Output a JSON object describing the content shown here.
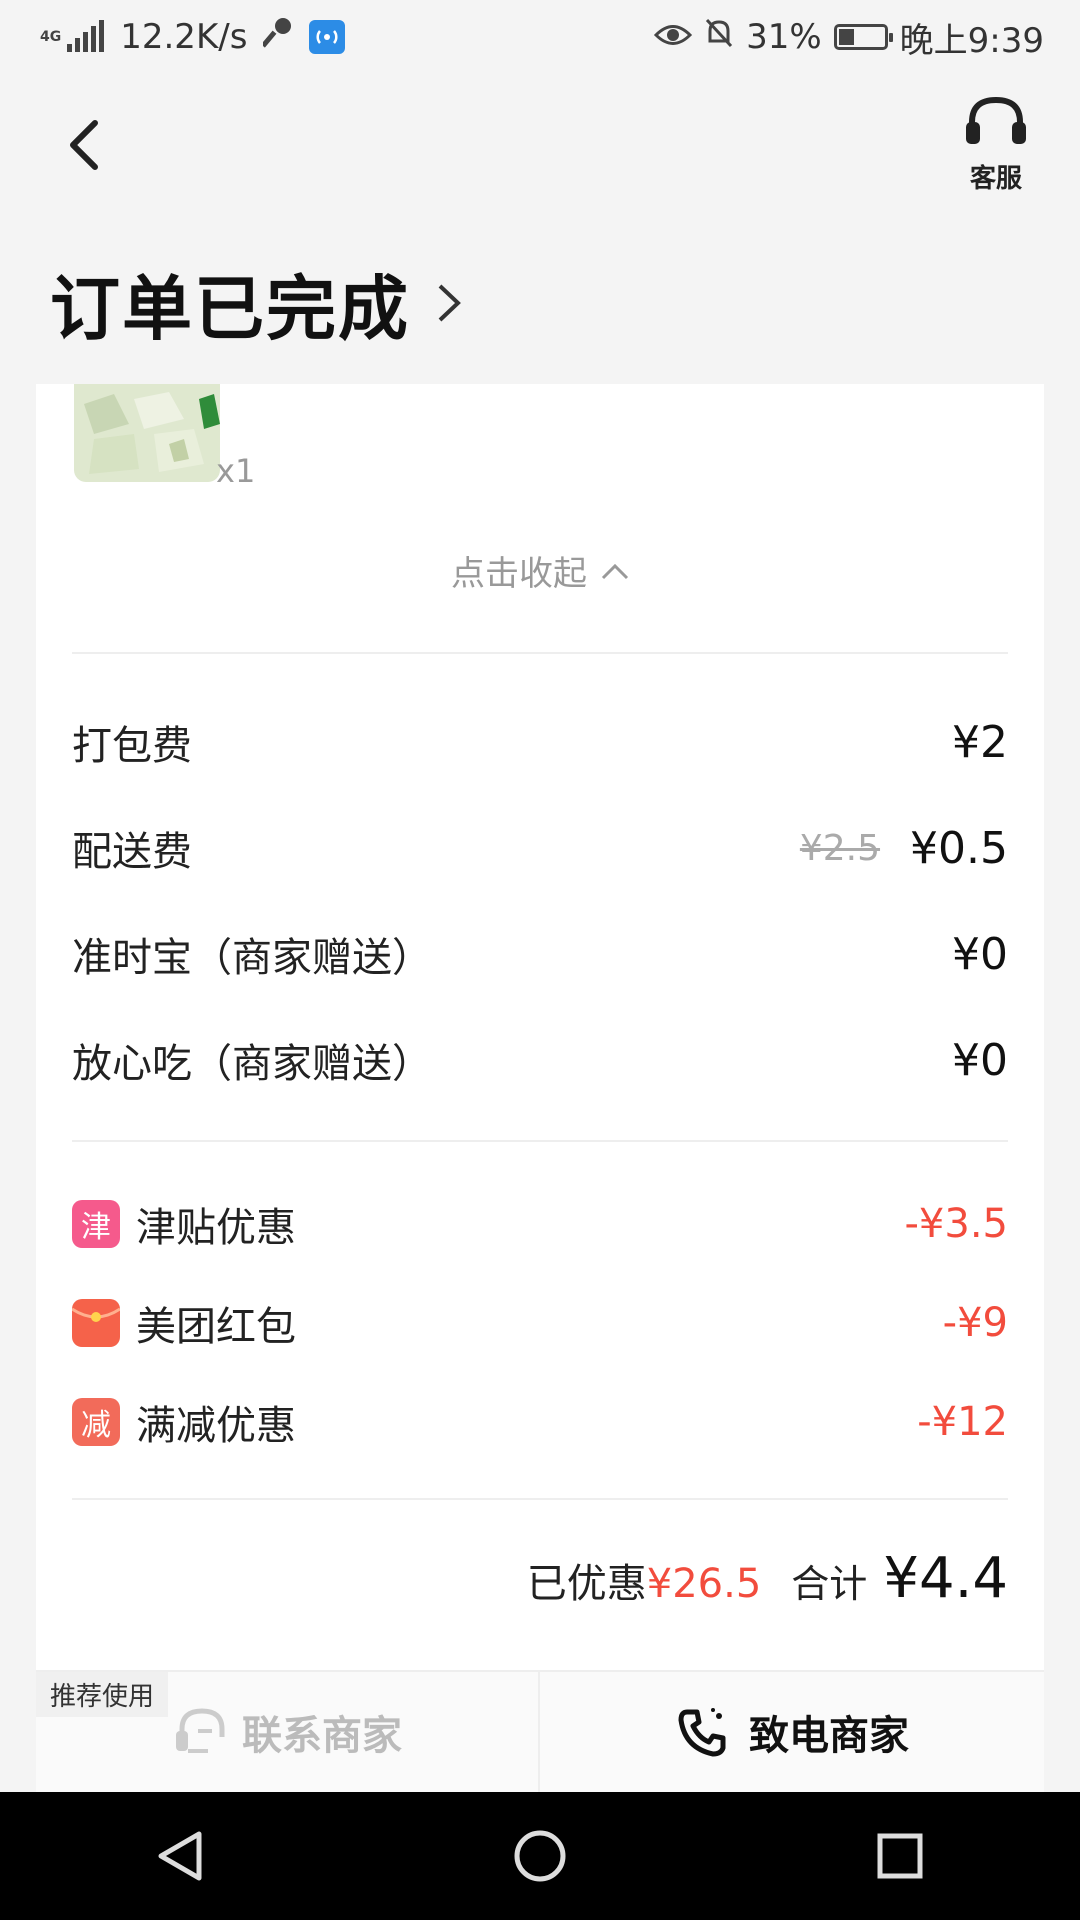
{
  "status_bar": {
    "network_type": "4G",
    "speed": "12.2K/s",
    "battery": "31%",
    "time": "晚上9:39",
    "battery_level": 0.31
  },
  "header": {
    "service_label": "客服",
    "title": "订单已完成"
  },
  "item": {
    "quantity": "x1",
    "collapse_label": "点击收起"
  },
  "fees": [
    {
      "label": "打包费",
      "value": "¥2"
    },
    {
      "label": "配送费",
      "original": "¥2.5",
      "value": "¥0.5"
    },
    {
      "label": "准时宝（商家赠送）",
      "value": "¥0"
    },
    {
      "label": "放心吃（商家赠送）",
      "value": "¥0"
    }
  ],
  "discounts": [
    {
      "badge": "津",
      "label": "津贴优惠",
      "amount": "-¥3.5",
      "color": "#f55a8c"
    },
    {
      "badge": "",
      "label": "美团红包",
      "amount": "-¥9",
      "color": "#f5624a"
    },
    {
      "badge": "减",
      "label": "满减优惠",
      "amount": "-¥12",
      "color": "#f26b5a"
    }
  ],
  "summary": {
    "saved_label": "已优惠",
    "saved_amount": "¥26.5",
    "total_label": "合计",
    "total_amount": "¥4.4"
  },
  "actions": {
    "recommend_tag": "推荐使用",
    "contact_label": "联系商家",
    "call_label": "致电商家"
  },
  "colors": {
    "accent_red": "#f24c3d",
    "hotspot_blue": "#2c8ce6"
  }
}
